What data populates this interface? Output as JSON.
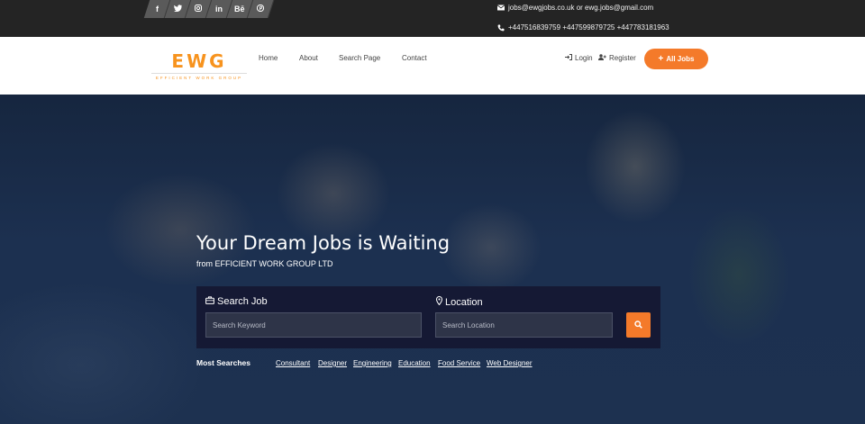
{
  "topbar": {
    "social": [
      "f",
      "t",
      "ig",
      "in",
      "Bē",
      "p"
    ],
    "social_icons": [
      "facebook-icon",
      "twitter-icon",
      "instagram-icon",
      "linkedin-icon",
      "behance-icon",
      "pinterest-icon"
    ],
    "email": "jobs@ewgjobs.co.uk or ewg.jobs@gmail.com",
    "phone": "+447516839759 +447599879725 +447783181963"
  },
  "header": {
    "logo_mark": "EWG",
    "logo_sub": "EFFICIENT WORK GROUP",
    "nav": [
      "Home",
      "About",
      "Search Page",
      "Contact"
    ],
    "login": "Login",
    "register": "Register",
    "all_jobs": "All Jobs"
  },
  "hero": {
    "title": "Your Dream Jobs is Waiting",
    "subtitle": "from EFFICIENT WORK GROUP LTD",
    "search_job_label": "Search Job",
    "location_label": "Location",
    "keyword_placeholder": "Search Keyword",
    "location_placeholder": "Search Location",
    "most_searches_label": "Most Searches",
    "tags": [
      "Consultant",
      "Designer",
      "Engineering",
      "Education",
      "Food Service",
      "Web Designer"
    ]
  },
  "colors": {
    "accent": "#f47a2a",
    "topbar": "#242424",
    "logo": "#f7931e"
  }
}
